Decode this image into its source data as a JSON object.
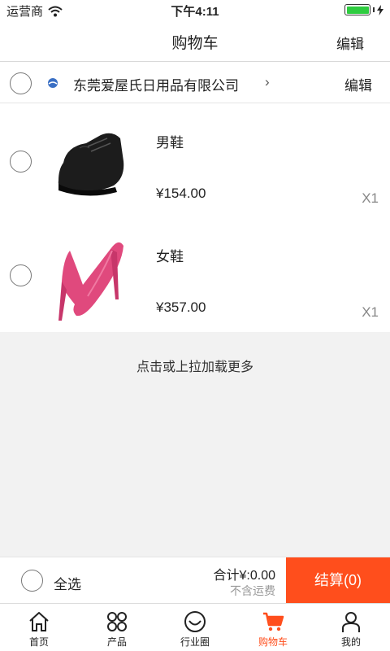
{
  "status": {
    "carrier": "运营商",
    "time": "下午4:11"
  },
  "nav": {
    "title": "购物车",
    "edit": "编辑"
  },
  "shop": {
    "name": "东莞爱屋氏日用品有限公司",
    "edit": "编辑"
  },
  "items": [
    {
      "name": "男鞋",
      "price": "¥154.00",
      "qty": "X1"
    },
    {
      "name": "女鞋",
      "price": "¥357.00",
      "qty": "X1"
    }
  ],
  "loadmore": "点击或上拉加载更多",
  "checkout": {
    "select_all": "全选",
    "total": "合计¥:0.00",
    "shipping": "不含运费",
    "pay": "结算(0)"
  },
  "tabs": [
    {
      "label": "首页",
      "icon": "home-icon"
    },
    {
      "label": "产品",
      "icon": "grid-icon"
    },
    {
      "label": "行业圈",
      "icon": "smile-icon"
    },
    {
      "label": "购物车",
      "icon": "cart-icon"
    },
    {
      "label": "我的",
      "icon": "user-icon"
    }
  ],
  "colors": {
    "accent": "#ff4e1c",
    "battery": "#2ecc40",
    "background_grey": "#f2f2f2"
  }
}
